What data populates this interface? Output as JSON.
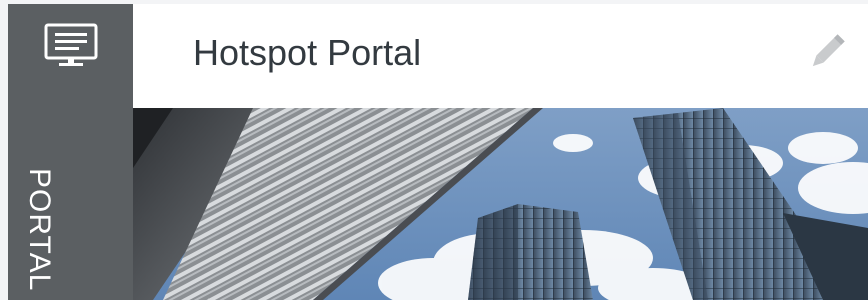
{
  "sidebar": {
    "icon": "monitor-icon",
    "label": "PORTAL"
  },
  "header": {
    "title": "Hotspot Portal",
    "edit_icon": "pencil-icon"
  },
  "colors": {
    "sidebar_bg": "#5b5f62",
    "header_bg": "#ffffff",
    "title_text": "#333a40"
  }
}
